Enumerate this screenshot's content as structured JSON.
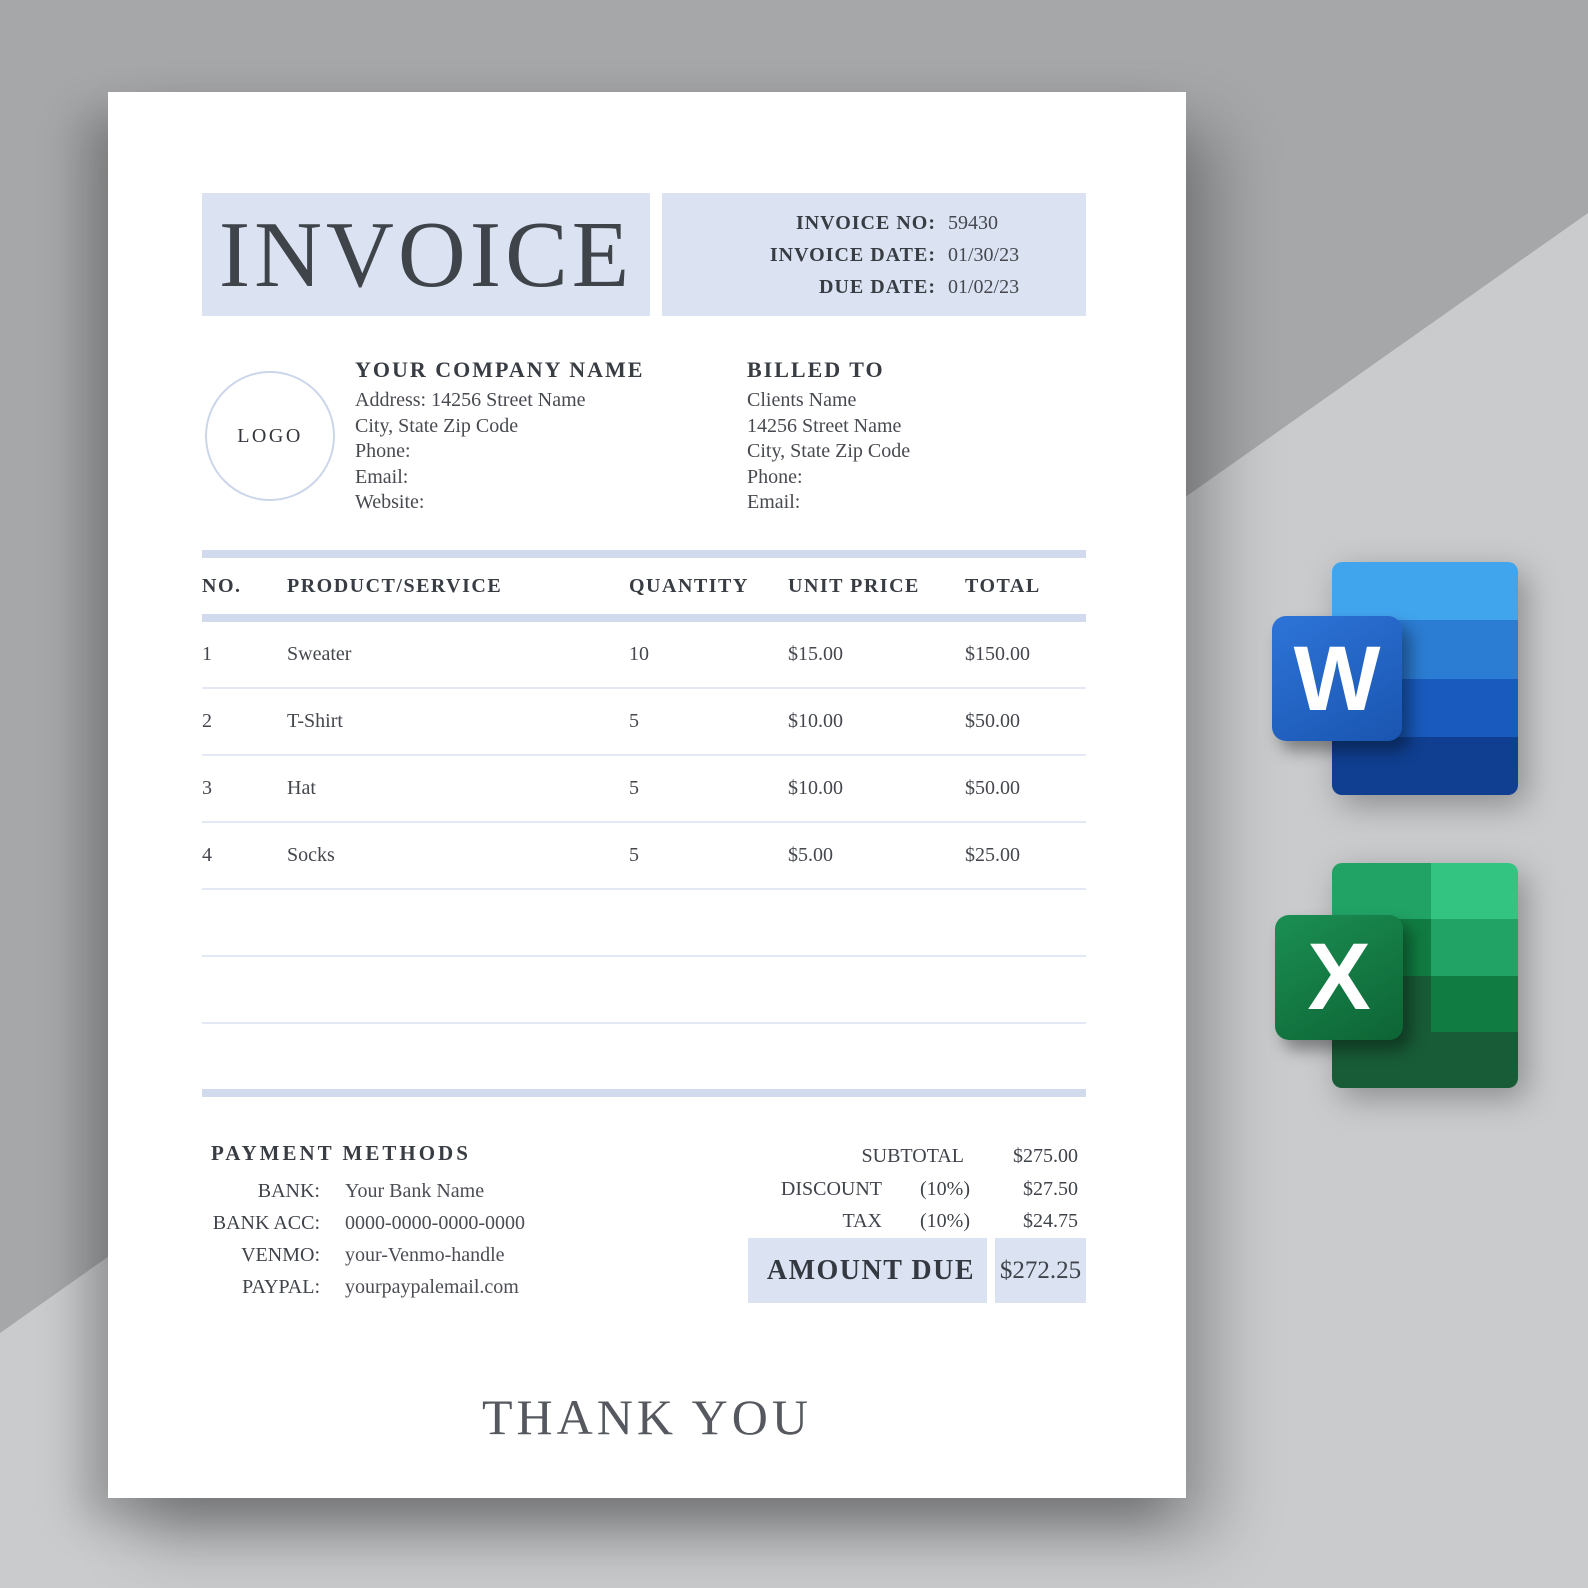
{
  "invoice": {
    "title": "INVOICE",
    "meta": [
      {
        "label": "INVOICE NO:",
        "value": "59430"
      },
      {
        "label": "INVOICE DATE:",
        "value": "01/30/23"
      },
      {
        "label": "DUE DATE:",
        "value": "01/02/23"
      }
    ],
    "logo_text": "LOGO",
    "company": {
      "heading": "YOUR COMPANY NAME",
      "lines": [
        "Address: 14256 Street Name",
        "City, State Zip Code",
        "Phone:",
        "Email:",
        "Website:"
      ]
    },
    "billed_to": {
      "heading": "BILLED TO",
      "lines": [
        "Clients Name",
        "14256 Street Name",
        "City, State Zip Code",
        "Phone:",
        "Email:"
      ]
    },
    "items_table": {
      "columns": [
        "NO.",
        "PRODUCT/SERVICE",
        "QUANTITY",
        "UNIT PRICE",
        "TOTAL"
      ],
      "rows": [
        [
          "1",
          "Sweater",
          "10",
          "$15.00",
          "$150.00"
        ],
        [
          "2",
          "T-Shirt",
          "5",
          "$10.00",
          "$50.00"
        ],
        [
          "3",
          "Hat",
          "5",
          "$10.00",
          "$50.00"
        ],
        [
          "4",
          "Socks",
          "5",
          "$5.00",
          "$25.00"
        ]
      ],
      "empty_row_count": 3
    },
    "payment_methods": {
      "heading": "PAYMENT METHODS",
      "rows": [
        {
          "label": "BANK:",
          "value": "Your Bank Name"
        },
        {
          "label": "BANK ACC:",
          "value": "0000-0000-0000-0000"
        },
        {
          "label": "VENMO:",
          "value": "your-Venmo-handle"
        },
        {
          "label": "PAYPAL:",
          "value": "yourpaypalemail.com"
        }
      ]
    },
    "totals": {
      "rows": [
        {
          "label": "SUBTOTAL",
          "pct": "",
          "amount": "$275.00"
        },
        {
          "label": "DISCOUNT",
          "pct": "(10%)",
          "amount": "$27.50"
        },
        {
          "label": "TAX",
          "pct": "(10%)",
          "amount": "$24.75"
        }
      ],
      "amount_due": {
        "label": "AMOUNT DUE",
        "value": "$272.25"
      }
    },
    "footer": {
      "thank_you": "THANK YOU"
    }
  },
  "app_icons": {
    "word": {
      "letter": "W",
      "stripe_colors": [
        "#41A5EE",
        "#2B7CD3",
        "#185ABD",
        "#103F91"
      ],
      "tile_color": "#185ABD"
    },
    "excel": {
      "letter": "X",
      "cell_colors": [
        "#21A366",
        "#33C481",
        "#107C41",
        "#185C37"
      ],
      "tile_color": "#107C41"
    }
  },
  "colors": {
    "accent_light_blue": "#dbe2f2",
    "table_bar_blue": "#d2dbee",
    "row_line_blue": "#e3e8f4",
    "heading_text": "#383c43",
    "body_text": "#474a50",
    "background_gray": "#a6a7a9",
    "background_light_gray": "#c9cbcd",
    "paper_white": "#ffffff"
  }
}
